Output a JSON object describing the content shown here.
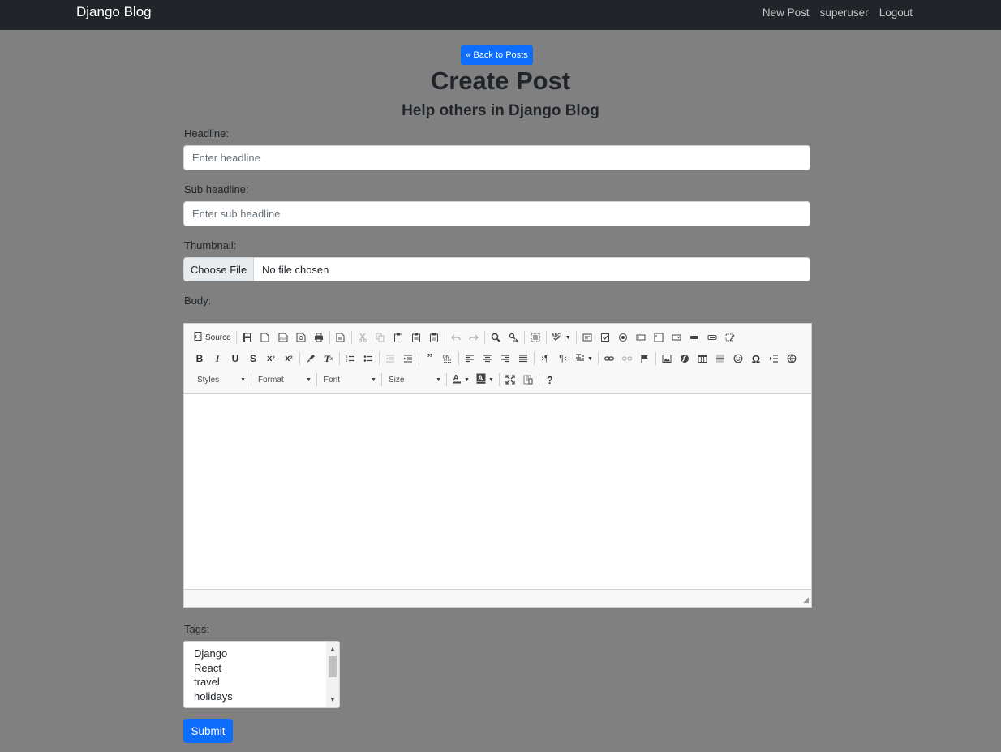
{
  "nav": {
    "brand": "Django Blog",
    "links": [
      "New Post",
      "superuser",
      "Logout"
    ]
  },
  "back_button": "« Back to Posts",
  "page": {
    "title": "Create Post",
    "subtitle": "Help others in Django Blog"
  },
  "form": {
    "headline_label": "Headline:",
    "headline_placeholder": "Enter headline",
    "subheadline_label": "Sub headline:",
    "subheadline_placeholder": "Enter sub headline",
    "thumbnail_label": "Thumbnail:",
    "file_button": "Choose File",
    "file_status": "No file chosen",
    "body_label": "Body:",
    "tags_label": "Tags:",
    "tags": [
      "Django",
      "React",
      "travel",
      "holidays"
    ],
    "submit": "Submit"
  },
  "editor": {
    "source_label": "Source",
    "combos": [
      "Styles",
      "Format",
      "Font",
      "Size"
    ],
    "icons_row1": [
      "source-icon",
      "save-icon",
      "new-page-icon",
      "export-pdf-icon",
      "preview-icon",
      "print-icon",
      "templates-icon",
      "cut-icon",
      "copy-icon",
      "paste-icon",
      "paste-text-icon",
      "paste-word-icon",
      "undo-icon",
      "redo-icon",
      "find-icon",
      "replace-icon",
      "select-all-icon",
      "spellcheck-icon",
      "form-icon",
      "checkbox-icon",
      "radio-icon",
      "textfield-icon",
      "textarea-icon",
      "select-icon",
      "button-icon",
      "image-button-icon",
      "hidden-field-icon"
    ],
    "icons_row2": [
      "bold-icon",
      "italic-icon",
      "underline-icon",
      "strike-icon",
      "subscript-icon",
      "superscript-icon",
      "copy-format-icon",
      "remove-format-icon",
      "numbered-list-icon",
      "bulleted-list-icon",
      "outdent-icon",
      "indent-icon",
      "blockquote-icon",
      "div-icon",
      "align-left-icon",
      "align-center-icon",
      "align-right-icon",
      "justify-icon",
      "ltr-icon",
      "rtl-icon",
      "language-icon",
      "link-icon",
      "unlink-icon",
      "anchor-icon",
      "image-icon",
      "flash-icon",
      "table-icon",
      "horizontal-rule-icon",
      "smiley-icon",
      "special-char-icon",
      "page-break-icon",
      "iframe-icon"
    ],
    "icons_row3": [
      "text-color-icon",
      "bg-color-icon",
      "maximize-icon",
      "show-blocks-icon",
      "help-icon"
    ]
  }
}
